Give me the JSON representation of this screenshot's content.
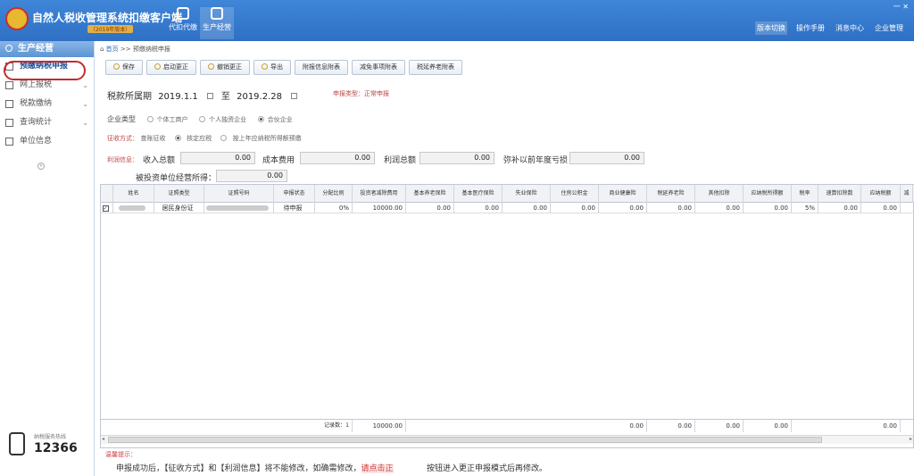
{
  "app": {
    "title": "自然人税收管理系统扣缴客户端",
    "subtitle": "（2019年版本）",
    "nav": [
      {
        "label": "代扣代缴",
        "active": false
      },
      {
        "label": "生产经营",
        "active": true
      }
    ],
    "right_links": [
      "版本切换",
      "操作手册",
      "消息中心",
      "企业管理"
    ],
    "window_controls": "一 ✕"
  },
  "sidebar": {
    "header": "生产经营",
    "items": [
      {
        "label": "预缴纳税申报",
        "icon": "report-icon",
        "active": true,
        "expandable": false
      },
      {
        "label": "网上报税",
        "icon": "send-icon",
        "active": false,
        "expandable": true
      },
      {
        "label": "税款缴纳",
        "icon": "payment-icon",
        "active": false,
        "expandable": true
      },
      {
        "label": "查询统计",
        "icon": "query-icon",
        "active": false,
        "expandable": true
      },
      {
        "label": "单位信息",
        "icon": "building-icon",
        "active": false,
        "expandable": false
      }
    ],
    "hotline_label": "纳税服务热线",
    "hotline_number": "12366"
  },
  "breadcrumb": {
    "home": "首页",
    "separator": ">>",
    "current": "预缴纳税申报"
  },
  "toolbar": [
    "保存",
    "启动更正",
    "撤销更正",
    "导出",
    "附报信息附表",
    "减免事项附表",
    "税延养老附表"
  ],
  "form": {
    "period_label": "税款所属期",
    "period_from": "2019.1.1",
    "period_to_label": "至",
    "period_to": "2019.2.28",
    "report_type": "申报类型：正常申报",
    "enterprise_type_label": "企业类型",
    "enterprise_types": [
      {
        "label": "个体工商户",
        "selected": false
      },
      {
        "label": "个人独资企业",
        "selected": false
      },
      {
        "label": "合伙企业",
        "selected": true
      }
    ],
    "collection_label": "征收方式：",
    "collection_methods": [
      {
        "label": "查账征收",
        "selected": true
      },
      {
        "label": "核定应税",
        "selected": false
      },
      {
        "label": "按上年应纳税所得额预缴",
        "selected": false
      }
    ],
    "profit_info_label": "利润信息：",
    "income_label": "收入总额",
    "income_value": "0.00",
    "cost_label": "成本费用",
    "cost_value": "0.00",
    "profit_label": "利润总额",
    "profit_value": "0.00",
    "loss_label": "弥补以前年度亏损",
    "loss_value": "0.00",
    "invested_label": "被投资单位经营所得：",
    "invested_value": "0.00"
  },
  "table": {
    "columns": [
      "姓名",
      "证照类型",
      "证照号码",
      "申报状态",
      "分配比例",
      "投资者减除费用",
      "基本养老保险",
      "基本医疗保险",
      "失业保险",
      "住房公积金",
      "商业健康险",
      "税延养老险",
      "其他扣除",
      "应纳税所得额",
      "税率",
      "速算扣除数",
      "应纳税额",
      "减"
    ],
    "rows": [
      {
        "id_type": "居民身份证",
        "status": "待申报",
        "ratio": "0%",
        "deduction": "10000.00",
        "pension": "0.00",
        "medical": "0.00",
        "unemployment": "0.00",
        "housing": "0.00",
        "health": "0.00",
        "deferred": "0.00",
        "other": "0.00",
        "taxable": "0.00",
        "rate": "5%",
        "quick": "0.00",
        "tax": "0.00"
      }
    ],
    "summary": {
      "label": "记录数：1",
      "deduction": "10000.00",
      "health": "0.00",
      "deferred": "0.00",
      "other": "0.00",
      "taxable": "0.00",
      "tax": "0.00"
    }
  },
  "tips": {
    "title": "温馨提示：",
    "line1": "申报成功后，【征收方式】和【利润信息】将不能修改，如确需修改，",
    "line1_highlight": "请点击",
    "line1_highlight2": "正",
    "line2": "按钮进入更正申报模式后再修改。"
  }
}
